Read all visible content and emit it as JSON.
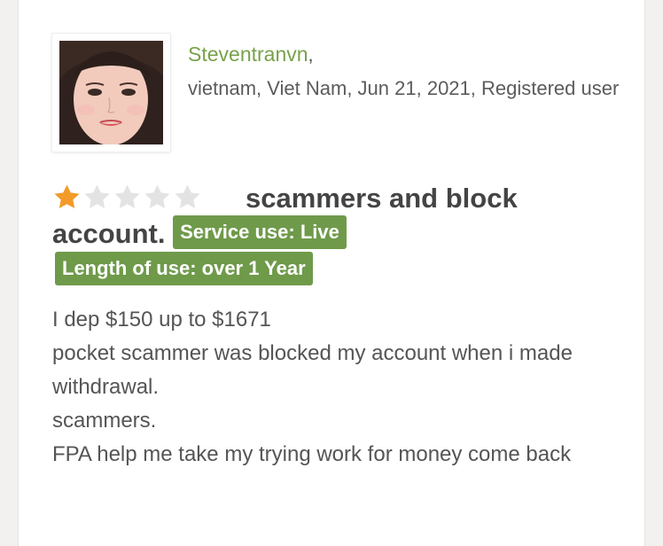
{
  "review": {
    "author": "Steventranvn",
    "author_suffix": ",",
    "meta_line": "vietnam, Viet Nam, Jun 21, 2021, Registered user",
    "rating": 1,
    "rating_max": 5,
    "star_color": "#f39a2a",
    "star_empty_color": "#e3e3e3",
    "title": "scammers and block account.",
    "tags": {
      "service": "Service use: Live",
      "length": "Length of use: over 1 Year"
    },
    "tag_color": "#6f9a4a",
    "author_color": "#78a14a",
    "body_lines": [
      "I dep $150 up to $1671",
      "pocket scammer was blocked my account when i made withdrawal.",
      "scammers.",
      "FPA help me take my trying work for money come back"
    ]
  }
}
